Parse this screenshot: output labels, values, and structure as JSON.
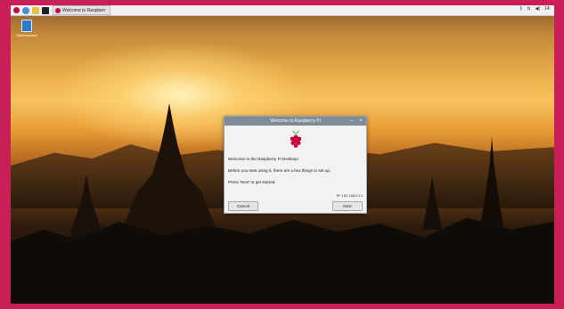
{
  "taskbar": {
    "task_title": "Welcome to Raspberr",
    "clock": "14:",
    "icons": [
      "raspberry-pi-menu-icon",
      "globe-icon",
      "folder-icon",
      "terminal-icon",
      "bluetooth-icon",
      "network-icon",
      "volume-icon"
    ]
  },
  "desktop": {
    "trash_label": "Wastebasket"
  },
  "dialog": {
    "title": "Welcome to Raspberry Pi",
    "minimize_glyph": "–",
    "close_glyph": "×",
    "welcome_text": "Welcome to the Raspberry Pi Desktop!",
    "before_text": "Before you start using it, there are a few things to set up.",
    "press_text": "Press 'Next' to get started.",
    "ip_text": "IP: 192.168.0.14",
    "cancel_label": "Cancel",
    "next_label": "Next"
  },
  "colors": {
    "frame": "#c81f57",
    "taskbar": "#f0f0f0",
    "dialog_title_bar": "#7f8b96",
    "raspberry": "#c7053d"
  }
}
